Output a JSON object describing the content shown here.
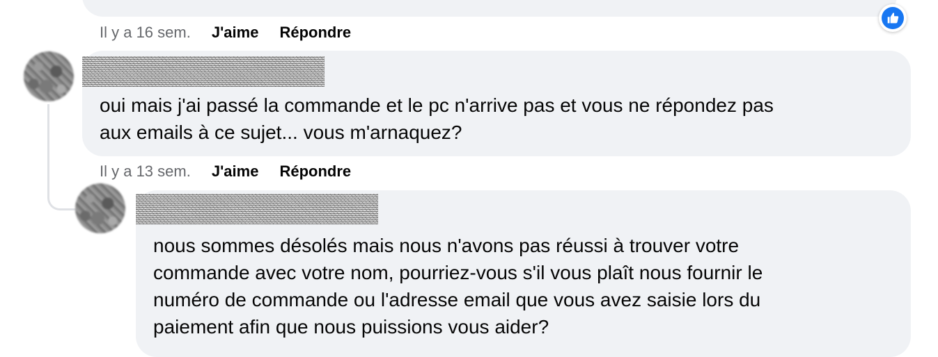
{
  "colors": {
    "bubble_bg": "#f0f2f5",
    "like_blue": "#1877f2",
    "meta_gray": "#65676b",
    "text": "#050505"
  },
  "previous_comment": {
    "time": "Il y a 16 sem.",
    "like_label": "J'aime",
    "reply_label": "Répondre",
    "reaction_icon": "thumbs-up-icon"
  },
  "comment_1": {
    "avatar": "blurred-avatar",
    "name": "",
    "text_lines": [
      "oui mais j'ai passé la commande et le pc n'arrive pas et vous ne répondez pas",
      "aux emails à ce sujet... vous m'arnaquez?"
    ],
    "time": "Il y a 13 sem.",
    "like_label": "J'aime",
    "reply_label": "Répondre"
  },
  "comment_2": {
    "avatar": "blurred-avatar",
    "name": "",
    "text_lines": [
      "nous sommes désolés mais nous n'avons pas réussi à trouver votre",
      "commande avec votre nom, pourriez-vous s'il vous plaît nous fournir le",
      "numéro de commande ou l'adresse email que vous avez saisie lors du",
      "paiement afin que nous puissions vous aider?"
    ]
  }
}
